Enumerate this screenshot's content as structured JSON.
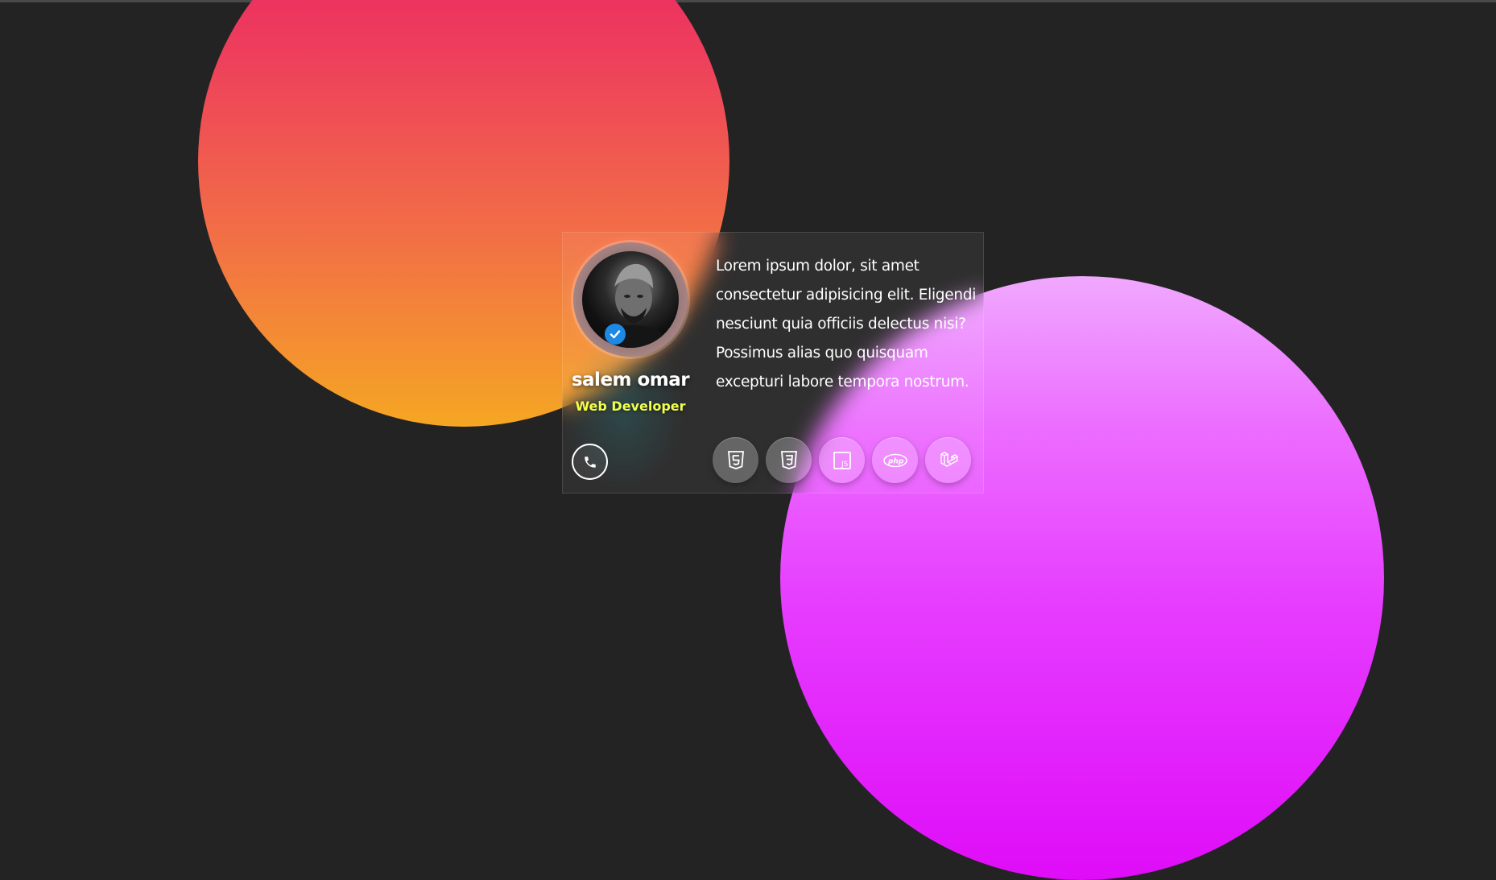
{
  "colors": {
    "background": "#232323",
    "blob_orange_top": "#e91e63",
    "blob_orange_bottom": "#f5a623",
    "blob_magenta_top": "#f0a8ff",
    "blob_magenta_bottom": "#df0cf8",
    "name_color": "#ffffff",
    "role_color": "#f2ff4a",
    "verified_badge": "#1e88e5"
  },
  "profile": {
    "name": "salem omar",
    "role": "Web Developer",
    "avatar_icon": "profile-photo",
    "verified_icon": "check-badge-icon"
  },
  "bio": {
    "text": "Lorem ipsum dolor, sit amet consectetur adipisicing elit. Eligendi nesciunt quia officiis delectus nisi? Possimus alias quo quisquam excepturi labore tempora nostrum."
  },
  "actions": {
    "call_icon": "phone-icon"
  },
  "skills": [
    {
      "icon": "html5-icon",
      "label": "5"
    },
    {
      "icon": "css3-icon",
      "label": "3"
    },
    {
      "icon": "javascript-icon",
      "label": "JS"
    },
    {
      "icon": "php-icon",
      "label": "php"
    },
    {
      "icon": "laravel-icon",
      "label": ""
    }
  ]
}
